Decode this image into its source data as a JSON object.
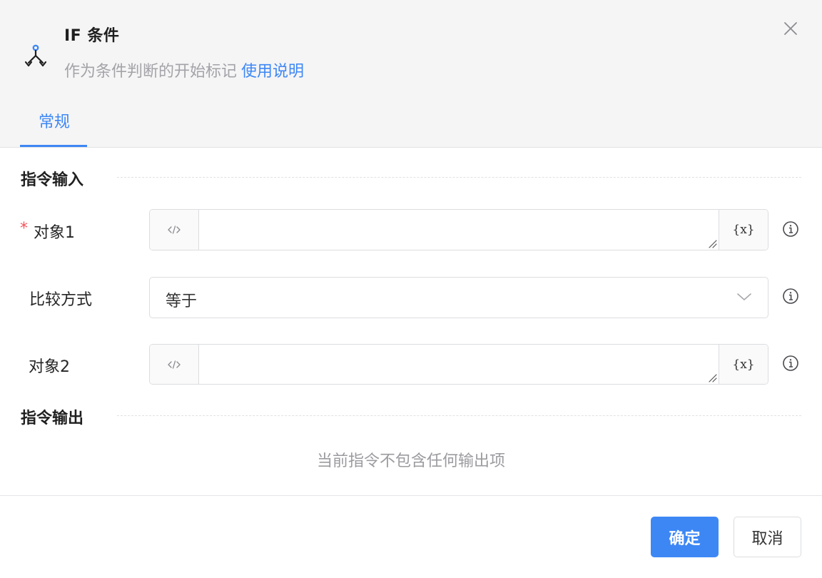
{
  "header": {
    "title": "IF 条件",
    "subtitle": "作为条件判断的开始标记",
    "help_link": "使用说明",
    "icon": "branch-split-icon",
    "close_icon": "close-icon"
  },
  "tabs": [
    {
      "label": "常规",
      "active": true
    }
  ],
  "input_section": {
    "title": "指令输入",
    "fields": [
      {
        "label": "对象1",
        "required": true,
        "value": "",
        "var_button": "{x}"
      },
      {
        "label": "比较方式",
        "type": "select",
        "value": "等于"
      },
      {
        "label": "对象2",
        "required": false,
        "value": "",
        "var_button": "{x}"
      }
    ]
  },
  "output_section": {
    "title": "指令输出",
    "empty_text": "当前指令不包含任何输出项"
  },
  "footer": {
    "confirm_label": "确定",
    "cancel_label": "取消"
  },
  "colors": {
    "accent": "#3d87f5",
    "required": "#f2545b",
    "header_bg": "#f5f5f6"
  }
}
